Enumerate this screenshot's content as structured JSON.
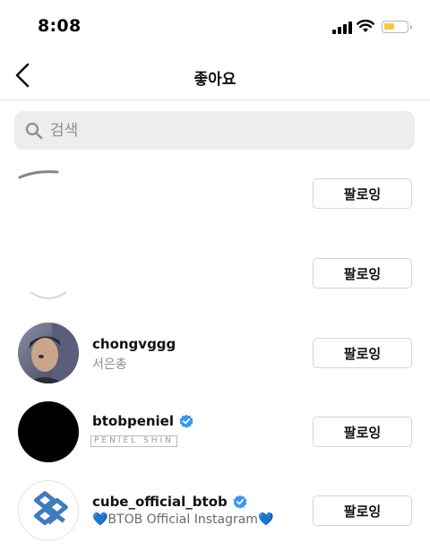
{
  "status_bar": {
    "time": "8:08"
  },
  "header": {
    "title": "좋아요"
  },
  "search": {
    "placeholder": "검색"
  },
  "users": [
    {
      "username": "",
      "subtitle": "",
      "button_label": "팔로잉"
    },
    {
      "username": "",
      "subtitle": "",
      "button_label": "팔로잉"
    },
    {
      "username": "chongvggg",
      "subtitle": "서은총",
      "button_label": "팔로잉"
    },
    {
      "username": "btobpeniel",
      "subtitle": "PENIEL SHIN",
      "button_label": "팔로잉",
      "verified": true
    },
    {
      "username": "cube_official_btob",
      "subtitle": "💙BTOB Official Instagram💙",
      "button_label": "팔로잉",
      "verified": true
    }
  ],
  "colors": {
    "verified_badge": "#3897f0",
    "button_border": "#d4d4d4",
    "battery_fill": "#f5c543",
    "search_bg": "#ededee"
  }
}
